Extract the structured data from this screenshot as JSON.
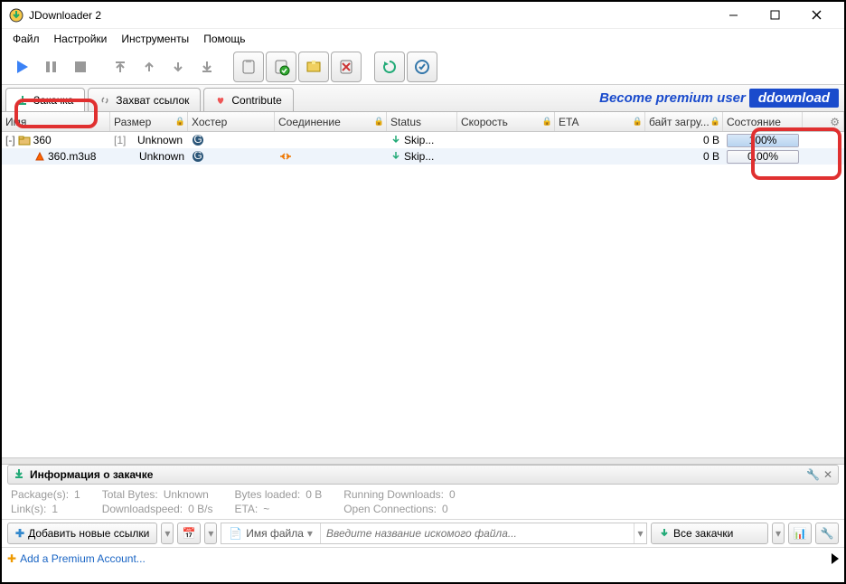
{
  "window": {
    "title": "JDownloader 2"
  },
  "menu": {
    "file": "Файл",
    "settings": "Настройки",
    "tools": "Инструменты",
    "help": "Помощь"
  },
  "tabs": {
    "downloads": "Закачка",
    "linkgrabber": "Захват ссылок",
    "contribute": "Contribute"
  },
  "premium": {
    "text": "Become premium user",
    "badge": "ddownload"
  },
  "columns": {
    "name": "Имя",
    "size": "Размер",
    "hoster": "Хостер",
    "connection": "Соединение",
    "status": "Status",
    "speed": "Скорость",
    "eta": "ETA",
    "bytesLoaded": "байт загру...",
    "state": "Состояние"
  },
  "rows": [
    {
      "expander": "[-]",
      "name": "360",
      "count": "[1]",
      "size": "Unknown",
      "status": "Skip...",
      "bytes": "0 B",
      "state": "100%",
      "pct": 100
    },
    {
      "expander": "",
      "name": "360.m3u8",
      "count": "",
      "size": "Unknown",
      "status": "Skip...",
      "bytes": "0 B",
      "state": "0,00%",
      "pct": 0
    }
  ],
  "info": {
    "title": "Информация о закачке",
    "packages_k": "Package(s):",
    "packages_v": "1",
    "totalbytes_k": "Total Bytes:",
    "totalbytes_v": "Unknown",
    "bytesloaded_k": "Bytes loaded:",
    "bytesloaded_v": "0 B",
    "running_k": "Running Downloads:",
    "running_v": "0",
    "links_k": "Link(s):",
    "links_v": "1",
    "dlspeed_k": "Downloadspeed:",
    "dlspeed_v": "0 B/s",
    "eta_k": "ETA:",
    "eta_v": "~",
    "openconn_k": "Open Connections:",
    "openconn_v": "0"
  },
  "bottom": {
    "addLinks": "Добавить новые ссылки",
    "filenameLabel": "Имя файла",
    "searchPlaceholder": "Введите название искомого файла...",
    "allDownloads": "Все закачки"
  },
  "status": {
    "addPremium": "Add a Premium Account..."
  }
}
